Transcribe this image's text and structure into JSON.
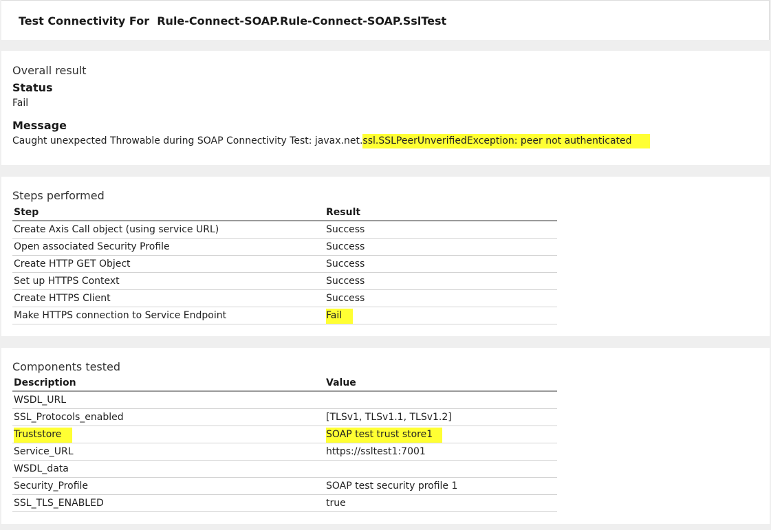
{
  "header": {
    "title": "Test Connectivity For  Rule-Connect-SOAP.Rule-Connect-SOAP.SslTest"
  },
  "overall": {
    "heading": "Overall result",
    "status_label": "Status",
    "status_value": "Fail",
    "message_label": "Message",
    "message_prefix": "Caught unexpected Throwable during SOAP Connectivity Test: javax.net.",
    "message_highlight": "ssl.SSLPeerUnverifiedException: peer not authenticated"
  },
  "steps": {
    "heading": "Steps performed",
    "columns": [
      "Step",
      "Result"
    ],
    "rows": [
      {
        "step": "Create Axis Call object (using service URL)",
        "result": "Success"
      },
      {
        "step": "Open associated Security Profile",
        "result": "Success"
      },
      {
        "step": "Create HTTP GET Object",
        "result": "Success"
      },
      {
        "step": "Set up HTTPS Context",
        "result": "Success"
      },
      {
        "step": "Create HTTPS Client",
        "result": "Success"
      },
      {
        "step": "Make HTTPS connection to Service Endpoint",
        "result": "Fail"
      }
    ]
  },
  "components": {
    "heading": "Components tested",
    "columns": [
      "Description",
      "Value"
    ],
    "rows": [
      {
        "description": "WSDL_URL",
        "value": ""
      },
      {
        "description": "SSL_Protocols_enabled",
        "value": "[TLSv1, TLSv1.1, TLSv1.2]"
      },
      {
        "description": "Truststore",
        "value": "SOAP test trust store1"
      },
      {
        "description": "Service_URL",
        "value": "https://ssltest1:7001"
      },
      {
        "description": "WSDL_data",
        "value": ""
      },
      {
        "description": "Security_Profile",
        "value": "SOAP test security profile 1"
      },
      {
        "description": "SSL_TLS_ENABLED",
        "value": "true"
      }
    ]
  },
  "colors": {
    "highlight": "#ffff33",
    "background": "#efefef",
    "panel": "#ffffff"
  }
}
